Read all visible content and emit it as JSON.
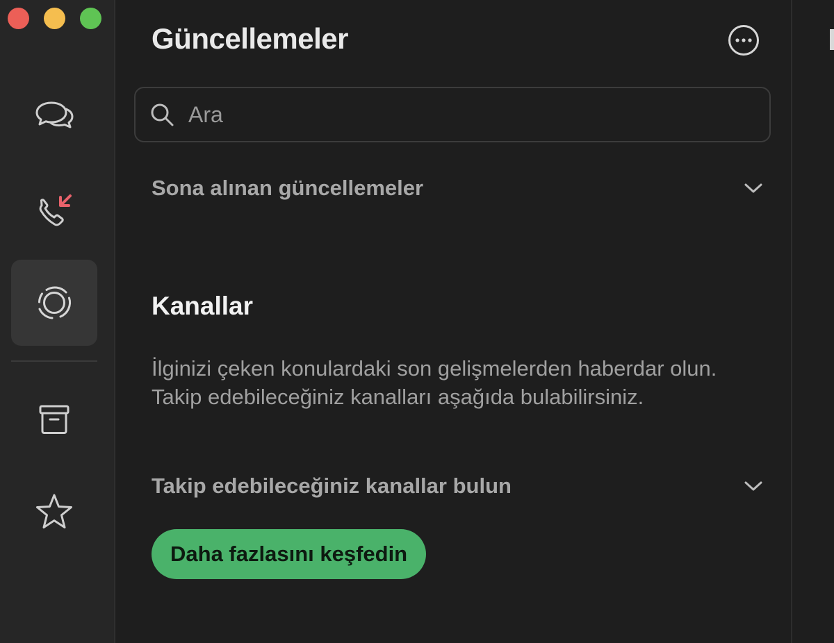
{
  "window": {
    "traffic_lights": {
      "close": "#ec5f57",
      "minimize": "#f5be4f",
      "zoom": "#5fc454"
    }
  },
  "sidebar": {
    "items": [
      {
        "name": "chats",
        "icon": "chat-bubbles-icon",
        "active": false
      },
      {
        "name": "calls",
        "icon": "phone-missed-icon",
        "active": false,
        "badge_color": "#e8626b"
      },
      {
        "name": "updates",
        "icon": "status-updates-icon",
        "active": true
      },
      {
        "name": "archived",
        "icon": "archive-box-icon",
        "active": false
      },
      {
        "name": "starred",
        "icon": "star-icon",
        "active": false
      }
    ]
  },
  "header": {
    "title": "Güncellemeler",
    "menu_icon": "more-options-icon"
  },
  "search": {
    "placeholder": "Ara",
    "value": ""
  },
  "recent_updates": {
    "label": "Sona alınan güncellemeler"
  },
  "channels": {
    "heading": "Kanallar",
    "description": "İlginizi çeken konulardaki son gelişmelerden haberdar olun. Takip edebileceğiniz kanalları aşağıda bulabilirsiniz.",
    "find_label": "Takip edebileceğiniz kanallar bulun",
    "explore_button": "Daha fazlasını keşfedin"
  },
  "colors": {
    "accent": "#4ab26a",
    "background": "#1e1e1e",
    "sidebar": "#262626"
  }
}
